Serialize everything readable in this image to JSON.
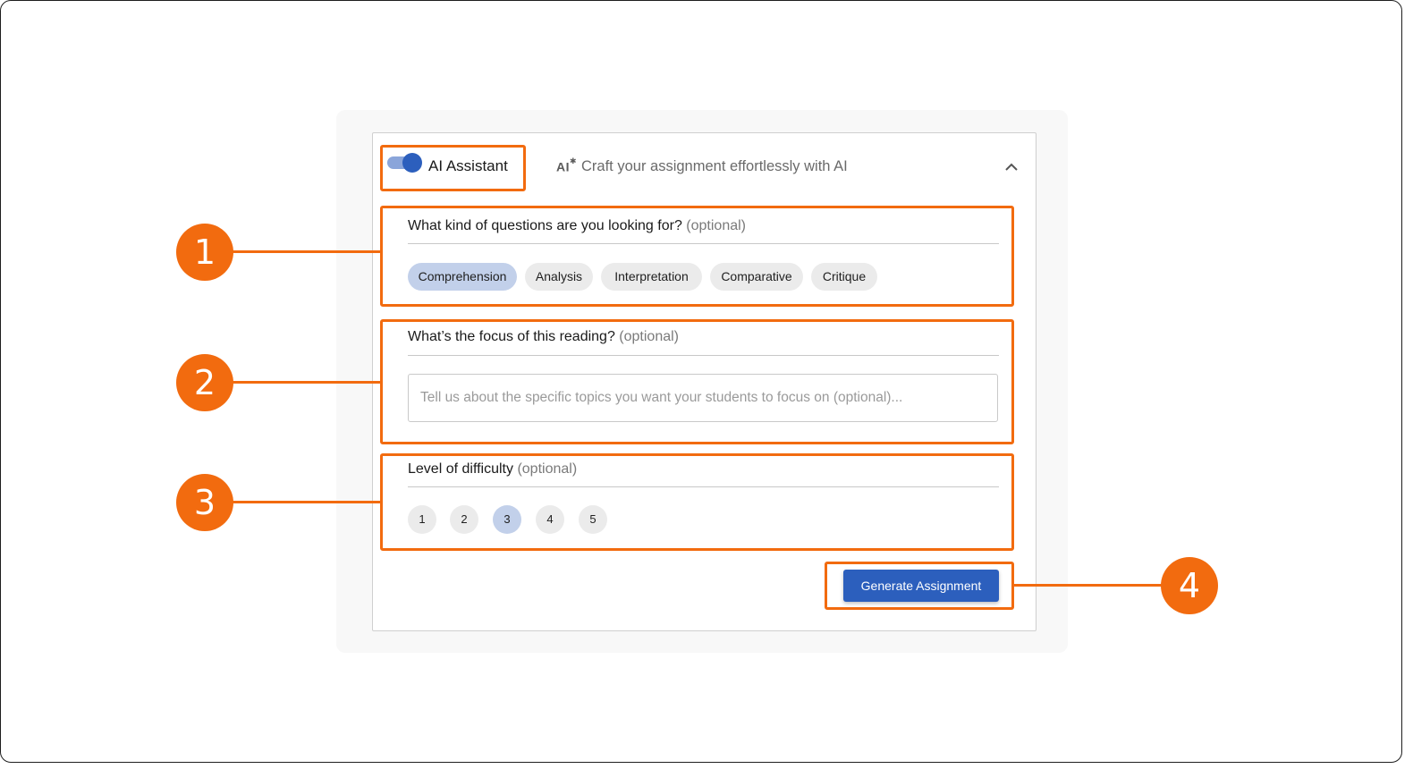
{
  "header": {
    "toggle_label": "AI Assistant",
    "toggle_on": true,
    "ai_badge": "AI",
    "tagline": "Craft your assignment effortlessly with AI"
  },
  "question_types": {
    "title": "What kind of questions are you looking for?",
    "optional": "(optional)",
    "chips": [
      "Comprehension",
      "Analysis",
      "Interpretation",
      "Comparative",
      "Critique"
    ],
    "selected": "Comprehension"
  },
  "focus": {
    "title": "What’s the focus of this reading?",
    "optional": "(optional)",
    "placeholder": "Tell us about the specific topics you want your students to focus on (optional)..."
  },
  "difficulty": {
    "title": "Level of difficulty",
    "optional": "(optional)",
    "levels": [
      "1",
      "2",
      "3",
      "4",
      "5"
    ],
    "selected": "3"
  },
  "actions": {
    "generate_label": "Generate Assignment"
  },
  "annotations": [
    "1",
    "2",
    "3",
    "4"
  ],
  "colors": {
    "accent_primary": "#2c5fbd",
    "annotation_orange": "#f26b0f",
    "chip_selected": "#c2d0ea"
  }
}
